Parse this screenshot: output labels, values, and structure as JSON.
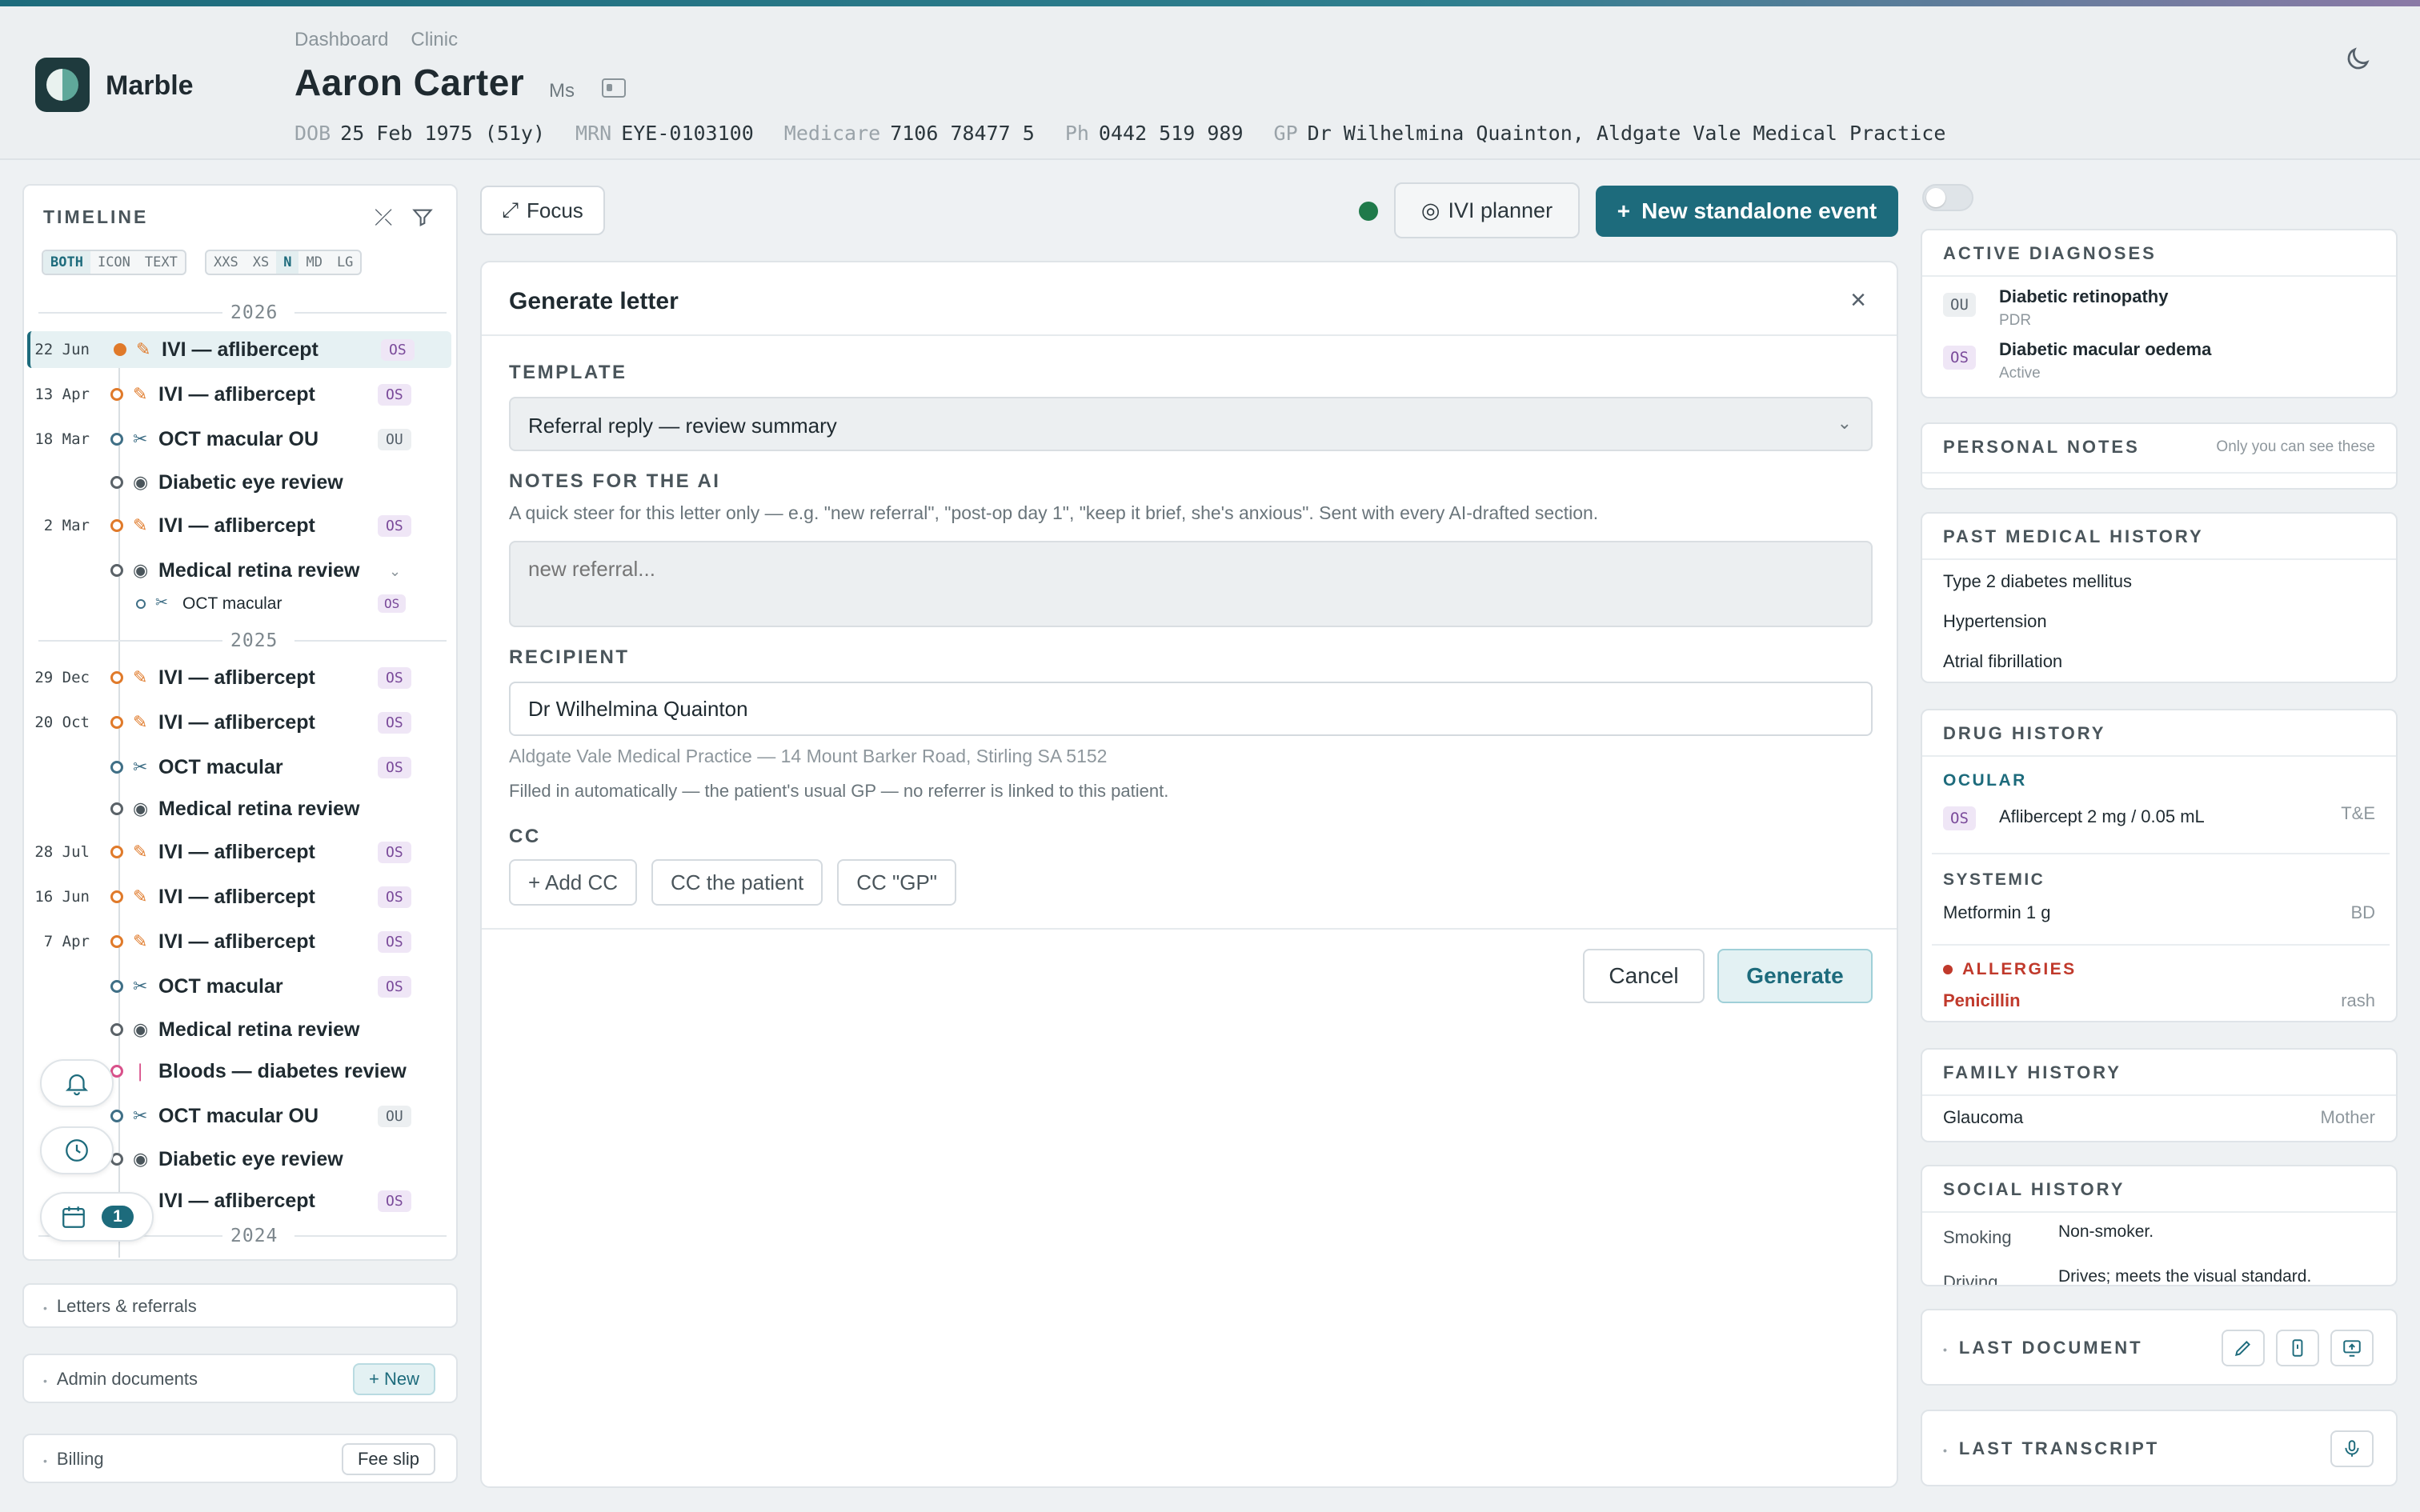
{
  "app": {
    "brand": "Marble"
  },
  "breadcrumbs": [
    "Dashboard",
    "Clinic"
  ],
  "patient": {
    "name": "Aaron Carter",
    "title": "Ms",
    "dob_label": "DOB",
    "dob": "25 Feb 1975 (51y)",
    "mrn_label": "MRN",
    "mrn": "EYE-0103100",
    "medicare_label": "Medicare",
    "medicare": "7106 78477 5",
    "ph_label": "Ph",
    "ph": "0442 519 989",
    "gp_label": "GP",
    "gp": "Dr Wilhelmina Quainton, Aldgate Vale Medical Practice"
  },
  "timeline": {
    "title": "TIMELINE",
    "modes": [
      "BOTH",
      "ICON",
      "TEXT"
    ],
    "sizes": [
      "XXS",
      "XS",
      "N",
      "MD",
      "LG"
    ],
    "year_2026": "2026",
    "year_2025": "2025",
    "year_2024": "2024",
    "events": [
      {
        "date": "22 Jun",
        "label": "IVI — aflibercept",
        "eye": "OS"
      },
      {
        "date": "13 Apr",
        "label": "IVI — aflibercept",
        "eye": "OS"
      },
      {
        "date": "18 Mar",
        "label": "OCT macular OU",
        "eye": "OU"
      },
      {
        "date": "",
        "label": "Diabetic eye review",
        "eye": ""
      },
      {
        "date": "2 Mar",
        "label": "IVI — aflibercept",
        "eye": "OS"
      },
      {
        "date": "",
        "label": "Medical retina review",
        "eye": ""
      },
      {
        "date": "",
        "label": "OCT macular",
        "eye": "OS"
      },
      {
        "date": "29 Dec",
        "label": "IVI — aflibercept",
        "eye": "OS"
      },
      {
        "date": "20 Oct",
        "label": "IVI — aflibercept",
        "eye": "OS"
      },
      {
        "date": "",
        "label": "OCT macular",
        "eye": "OS"
      },
      {
        "date": "",
        "label": "Medical retina review",
        "eye": ""
      },
      {
        "date": "28 Jul",
        "label": "IVI — aflibercept",
        "eye": "OS"
      },
      {
        "date": "16 Jun",
        "label": "IVI — aflibercept",
        "eye": "OS"
      },
      {
        "date": "7 Apr",
        "label": "IVI — aflibercept",
        "eye": "OS"
      },
      {
        "date": "",
        "label": "OCT macular",
        "eye": "OS"
      },
      {
        "date": "",
        "label": "Medical retina review",
        "eye": ""
      },
      {
        "date": "",
        "label": "Bloods — diabetes review",
        "eye": ""
      },
      {
        "date": "",
        "label": "OCT macular OU",
        "eye": "OU"
      },
      {
        "date": "",
        "label": "Diabetic eye review",
        "eye": ""
      },
      {
        "date": "",
        "label": "IVI — aflibercept",
        "eye": "OS"
      }
    ],
    "calendar_count": "1"
  },
  "left_cards": {
    "letters": "Letters & referrals",
    "admin": "Admin documents",
    "admin_btn": "+ New",
    "billing": "Billing",
    "billing_btn": "Fee slip"
  },
  "toolbar": {
    "focus": "Focus",
    "ivi_planner": "IVI planner",
    "new_event": "New standalone event"
  },
  "modal": {
    "title": "Generate letter",
    "template_label": "TEMPLATE",
    "template_value": "Referral reply — review summary",
    "notes_label": "NOTES FOR THE AI",
    "notes_hint": "A quick steer for this letter only — e.g. \"new referral\", \"post-op day 1\", \"keep it brief, she's anxious\". Sent with every AI-drafted section.",
    "notes_placeholder": "new referral...",
    "recipient_label": "RECIPIENT",
    "recipient_value": "Dr Wilhelmina Quainton",
    "recipient_address": "Aldgate Vale Medical Practice — 14 Mount Barker Road, Stirling SA 5152",
    "recipient_note": "Filled in automatically — the patient's usual GP — no referrer is linked to this patient.",
    "cc_label": "CC",
    "cc_buttons": [
      "+ Add CC",
      "CC the patient",
      "CC \"GP\""
    ],
    "cancel": "Cancel",
    "generate": "Generate"
  },
  "right": {
    "active_dx_title": "ACTIVE DIAGNOSES",
    "dx": [
      {
        "eye": "OU",
        "name": "Diabetic retinopathy",
        "sub": "PDR"
      },
      {
        "eye": "OS",
        "name": "Diabetic macular oedema",
        "sub": "Active"
      }
    ],
    "personal_notes_title": "PERSONAL NOTES",
    "personal_notes_hint": "Only you can see these",
    "pmh_title": "PAST MEDICAL HISTORY",
    "pmh": [
      "Type 2 diabetes mellitus",
      "Hypertension",
      "Atrial fibrillation"
    ],
    "drug_title": "DRUG HISTORY",
    "ocular_label": "OCULAR",
    "ocular_drug_eye": "OS",
    "ocular_drug": "Aflibercept 2 mg / 0.05 mL",
    "ocular_drug_freq": "T&E",
    "systemic_label": "SYSTEMIC",
    "systemic_drug": "Metformin 1 g",
    "systemic_freq": "BD",
    "allergies_label": "ALLERGIES",
    "allergy": "Penicillin",
    "allergy_reaction": "rash",
    "family_title": "FAMILY HISTORY",
    "family_item": "Glaucoma",
    "family_relation": "Mother",
    "social_title": "SOCIAL HISTORY",
    "social": [
      {
        "k": "Smoking",
        "v": "Non-smoker."
      },
      {
        "k": "Driving",
        "v": "Drives; meets the visual standard."
      }
    ],
    "last_document": "LAST DOCUMENT",
    "last_transcript": "LAST TRANSCRIPT"
  },
  "colors": {
    "accent": "#1d6b7c",
    "ivi": "#e07a2a",
    "allergy": "#c0392b"
  }
}
